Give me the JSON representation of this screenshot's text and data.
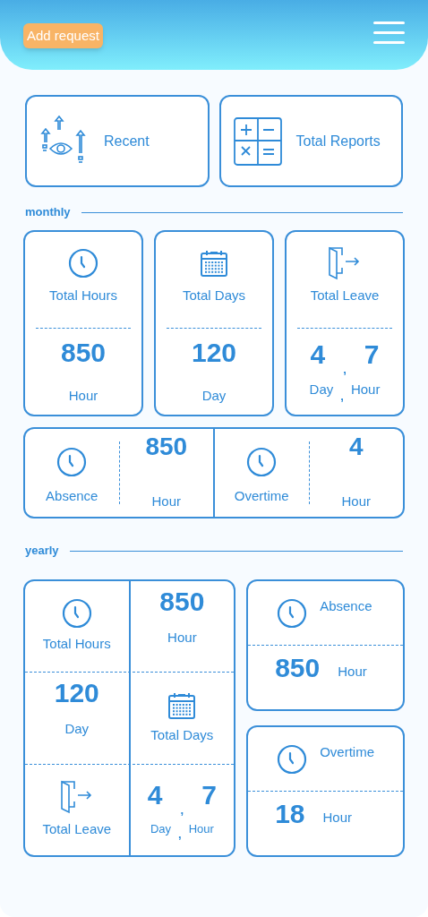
{
  "header": {
    "add_button": "Add request"
  },
  "shortcuts": [
    {
      "kind": "recent",
      "label": "Recent"
    },
    {
      "kind": "reports",
      "label": "Total Reports"
    }
  ],
  "monthly": {
    "title": "monthly",
    "cards": [
      {
        "kind": "hours",
        "label": "Total Hours",
        "value": "850",
        "unit": "Hour"
      },
      {
        "kind": "days",
        "label": "Total Days",
        "value": "120",
        "unit": "Day"
      },
      {
        "kind": "leave",
        "label": "Total Leave",
        "value": "4",
        "separator": ",",
        "value_2": "7",
        "unit": "Day",
        "unit_separator": ",",
        "unit_2": "Hour"
      }
    ],
    "summary": [
      {
        "label": "Absence",
        "value": "850",
        "unit": "Hour"
      },
      {
        "label": "Overtime",
        "value": "4",
        "unit": "Hour"
      }
    ]
  },
  "yearly": {
    "title": "yearly",
    "grid": [
      {
        "kind": "hours_label",
        "label": "Total Hours"
      },
      {
        "kind": "value",
        "value": "850",
        "unit": "Hour"
      },
      {
        "kind": "value",
        "value": "120",
        "unit": "Day"
      },
      {
        "kind": "days_label",
        "label": "Total Days"
      },
      {
        "kind": "leave_label",
        "label": "Total Leave"
      },
      {
        "kind": "leave_value",
        "value": "4",
        "separator": ",",
        "value_2": "7",
        "unit": "Day",
        "unit_separator": ",",
        "unit_2": "Hour"
      }
    ],
    "side": [
      {
        "label": "Absence",
        "value": "850",
        "unit": "Hour"
      },
      {
        "label": "Overtime",
        "value": "18",
        "unit": "Hour"
      }
    ]
  }
}
